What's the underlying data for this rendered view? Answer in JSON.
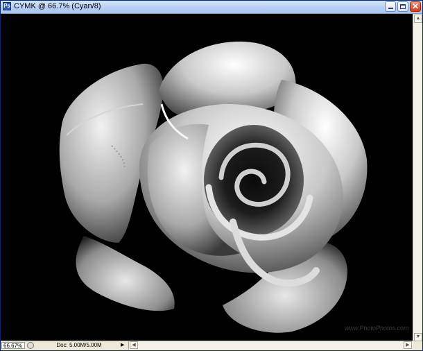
{
  "window": {
    "title": "CYMK @ 66.7% (Cyan/8)",
    "app_icon": "Ps"
  },
  "canvas": {
    "watermark": "www.PhotoPhotos.com"
  },
  "status": {
    "zoom": "66.67%",
    "doc": "Doc: 5.00M/5.00M"
  }
}
